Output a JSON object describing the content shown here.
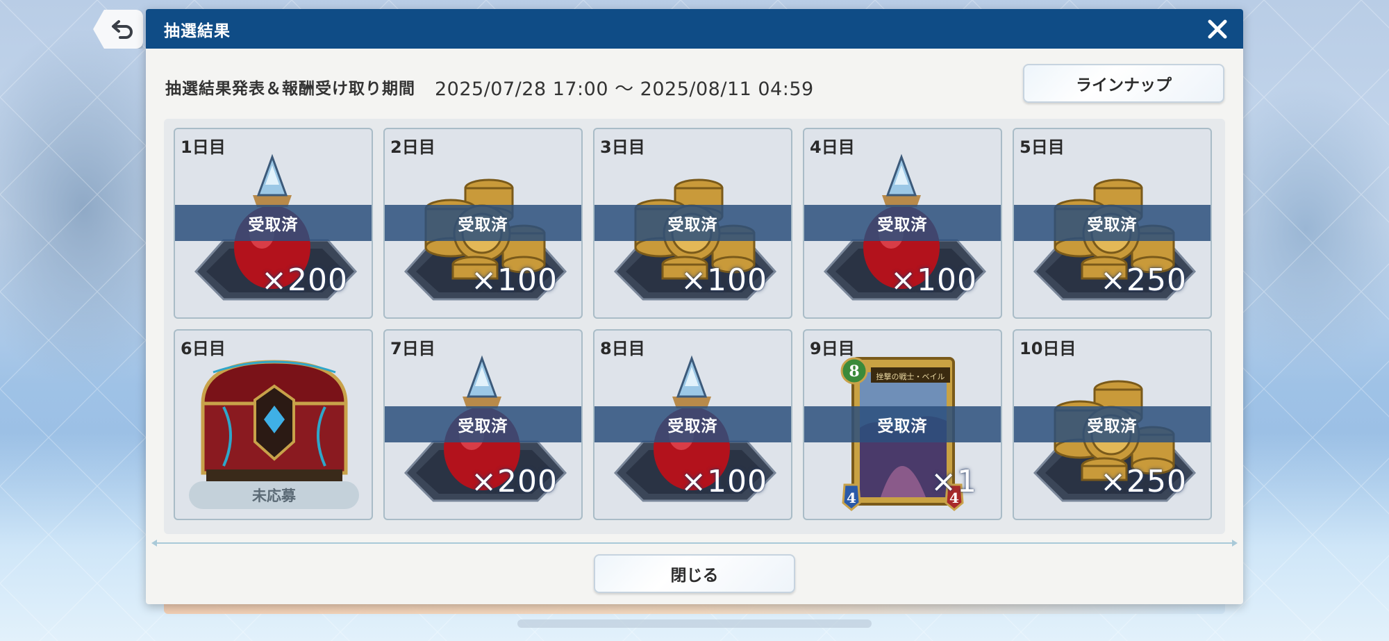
{
  "dialog": {
    "title": "抽選結果",
    "period_label": "抽選結果発表＆報酬受け取り期間",
    "period_range": "2025/07/28 17:00 ～ 2025/08/11 04:59",
    "lineup_button": "ラインナップ",
    "close_button": "閉じる"
  },
  "days": [
    {
      "label": "1日目",
      "item": "potion",
      "quantity": "×200",
      "status": "受取済"
    },
    {
      "label": "2日目",
      "item": "coins",
      "quantity": "×100",
      "status": "受取済"
    },
    {
      "label": "3日目",
      "item": "coins",
      "quantity": "×100",
      "status": "受取済"
    },
    {
      "label": "4日目",
      "item": "potion",
      "quantity": "×100",
      "status": "受取済"
    },
    {
      "label": "5日目",
      "item": "coins",
      "quantity": "×250",
      "status": "受取済"
    },
    {
      "label": "6日目",
      "item": "treasure-chest",
      "quantity": "",
      "status": "未応募"
    },
    {
      "label": "7日目",
      "item": "potion",
      "quantity": "×200",
      "status": "受取済"
    },
    {
      "label": "8日目",
      "item": "potion",
      "quantity": "×100",
      "status": "受取済"
    },
    {
      "label": "9日目",
      "item": "card",
      "quantity": "×1",
      "status": "受取済",
      "card": {
        "cost": "8",
        "name": "挫撃の戦士・ベイル",
        "attack": "4",
        "defense": "4"
      }
    },
    {
      "label": "10日目",
      "item": "coins",
      "quantity": "×250",
      "status": "受取済"
    }
  ],
  "colors": {
    "titlebar": "#0f4c86",
    "claimed_band": "#2d507d",
    "cell_border": "#a9bcc7"
  },
  "icons": {
    "back": "back-arrow-icon",
    "close": "close-icon"
  }
}
